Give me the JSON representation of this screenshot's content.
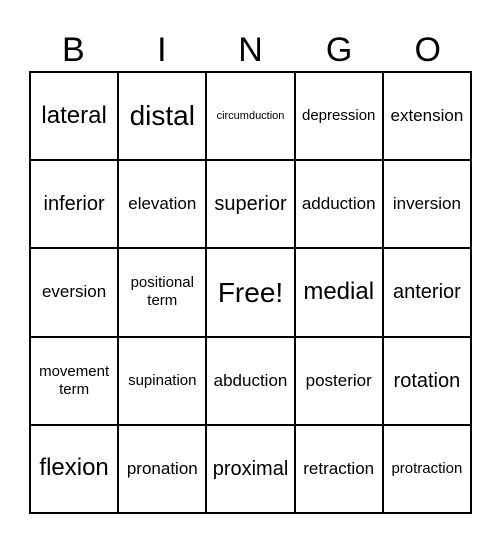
{
  "header": [
    "B",
    "I",
    "N",
    "G",
    "O"
  ],
  "cells": [
    [
      "lateral",
      "distal",
      "circumduction",
      "depression",
      "extension"
    ],
    [
      "inferior",
      "elevation",
      "superior",
      "adduction",
      "inversion"
    ],
    [
      "eversion",
      "positional term",
      "Free!",
      "medial",
      "anterior"
    ],
    [
      "movement term",
      "supination",
      "abduction",
      "posterior",
      "rotation"
    ],
    [
      "flexion",
      "pronation",
      "proximal",
      "retraction",
      "protraction"
    ]
  ]
}
